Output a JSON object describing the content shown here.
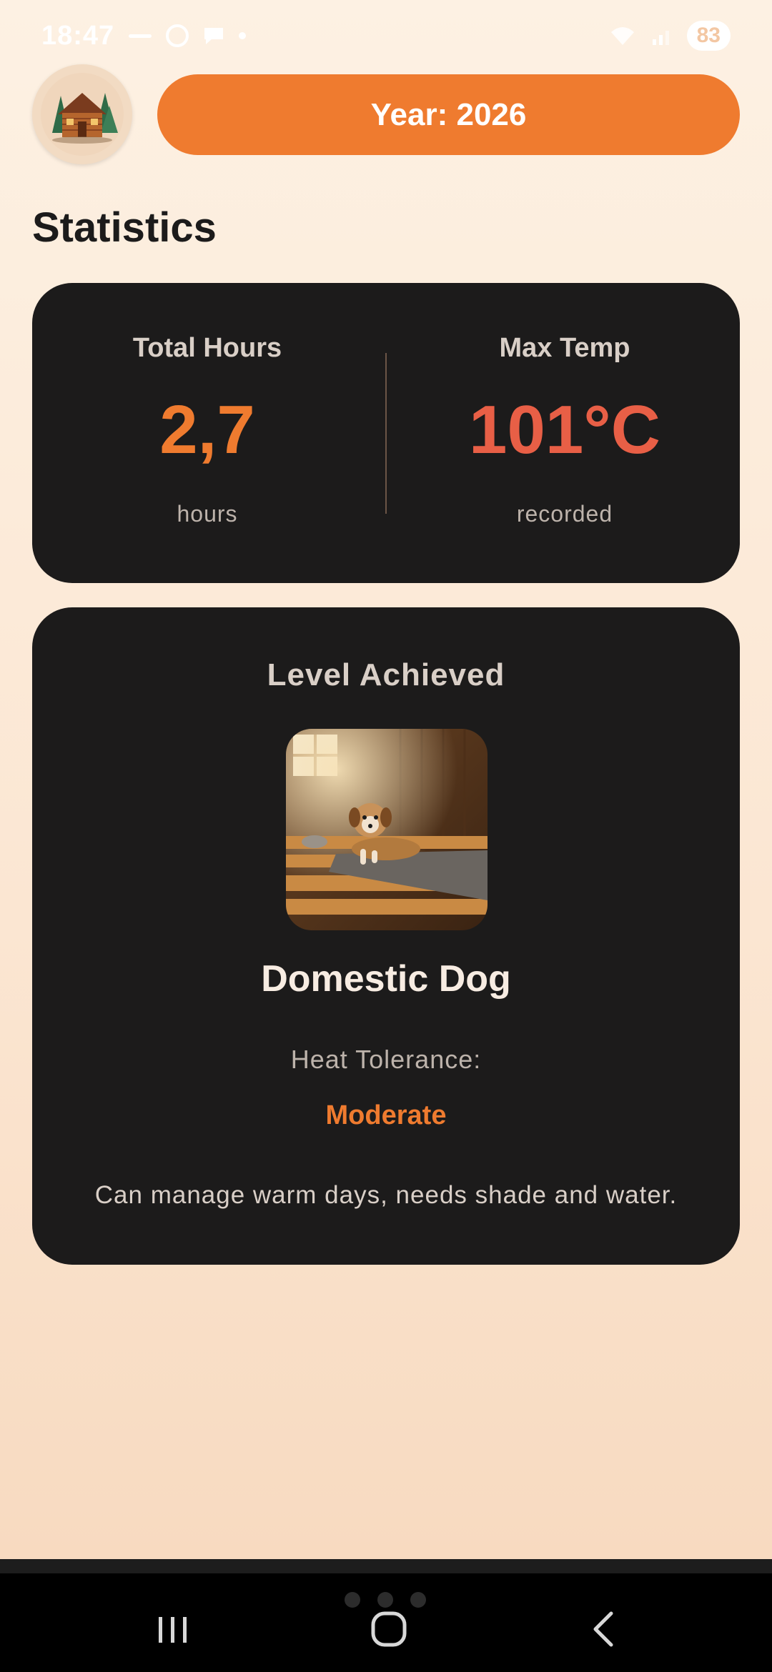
{
  "status_bar": {
    "time": "18:47",
    "battery": "83",
    "icons": [
      "link-icon",
      "circle-icon",
      "chat-bubble-icon",
      "dot-icon",
      "wifi-icon",
      "signal-icon",
      "battery-icon"
    ]
  },
  "header": {
    "avatar_icon": "log-cabin-icon",
    "year_label": "Year: 2026"
  },
  "page": {
    "title": "Statistics"
  },
  "stats": {
    "total_hours": {
      "label": "Total Hours",
      "value": "2,7",
      "unit": "hours",
      "color": "#ef7b2f"
    },
    "max_temp": {
      "label": "Max Temp",
      "value": "101°C",
      "unit": "recorded",
      "color": "#e85f46"
    }
  },
  "level": {
    "title": "Level Achieved",
    "image_icon": "dog-in-sauna-image",
    "name": "Domestic Dog",
    "heat_tolerance_label": "Heat Tolerance:",
    "heat_tolerance_value": "Moderate",
    "description": "Can manage warm days, needs shade and water."
  },
  "colors": {
    "accent": "#ef7b2f",
    "card_bg": "#1c1b1b",
    "temperature": "#e85f46"
  },
  "nav_bar": {
    "buttons": [
      "recent-apps-icon",
      "home-icon",
      "back-icon"
    ]
  }
}
